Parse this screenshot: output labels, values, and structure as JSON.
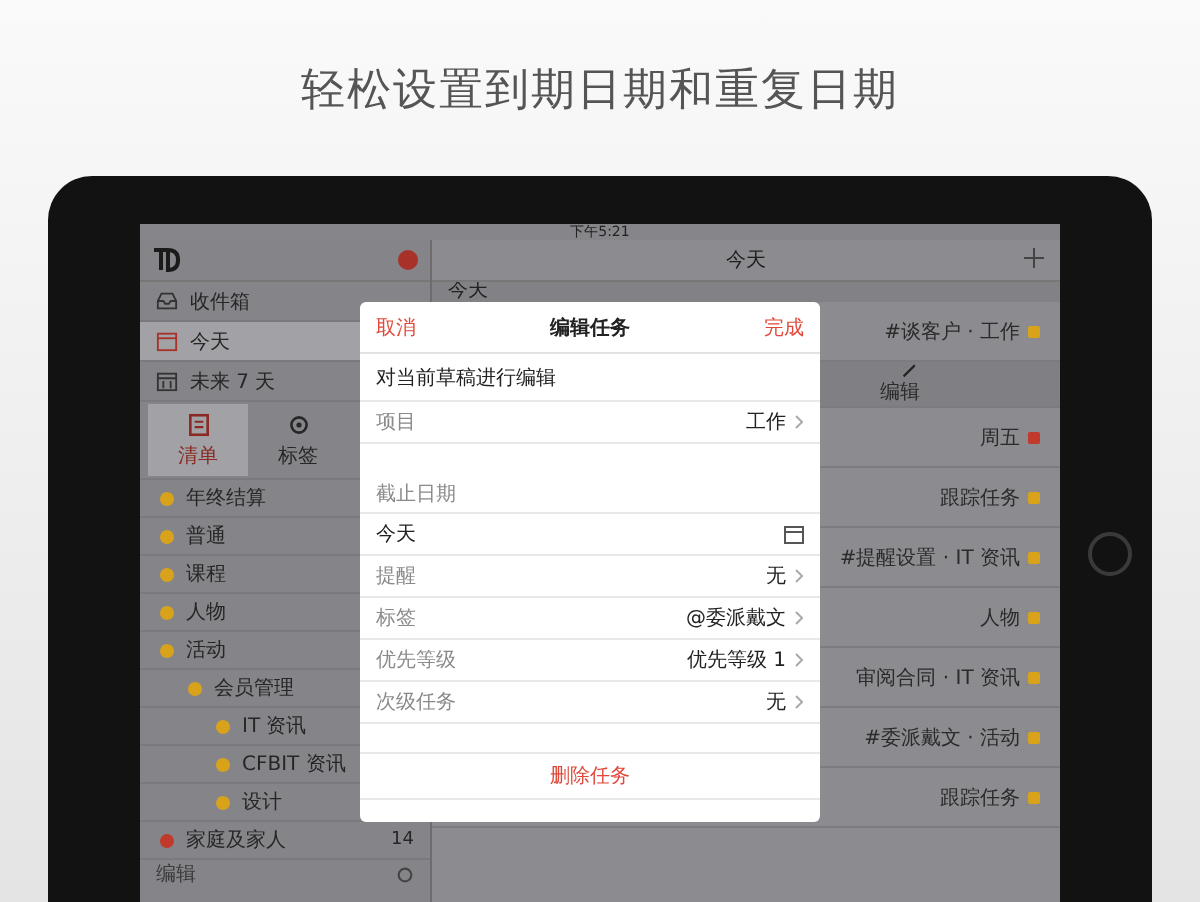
{
  "headline": "轻松设置到期日期和重复日期",
  "status_bar": {
    "time": "下午5:21"
  },
  "sidebar": {
    "items": [
      {
        "kind": "inbox",
        "label": "收件箱",
        "selected": false
      },
      {
        "kind": "today",
        "label": "今天",
        "selected": true
      },
      {
        "kind": "week",
        "label": "未来 7 天",
        "selected": false
      }
    ],
    "tabs": [
      {
        "kind": "lists",
        "label": "清单",
        "selected": true
      },
      {
        "kind": "labels",
        "label": "标签",
        "selected": false
      }
    ],
    "lists": [
      {
        "label": "年终结算",
        "color": "#d9a21b"
      },
      {
        "label": "普通",
        "color": "#d9a21b"
      },
      {
        "label": "课程",
        "color": "#d9a21b"
      },
      {
        "label": "人物",
        "color": "#d9a21b"
      },
      {
        "label": "活动",
        "color": "#d9a21b",
        "children": [
          {
            "label": "会员管理",
            "color": "#d9a21b",
            "children": [
              {
                "label": "IT 资讯",
                "color": "#d9a21b"
              },
              {
                "label": "CFBIT 资讯",
                "color": "#d9a21b"
              },
              {
                "label": "设计",
                "color": "#d9a21b"
              }
            ]
          }
        ]
      },
      {
        "label": "家庭及家人",
        "color": "#c0392b",
        "count": "14"
      }
    ],
    "footer": {
      "label": "编辑"
    }
  },
  "main": {
    "title": "今天",
    "section": "今天",
    "tasks": [
      {
        "kind": "task",
        "text": "#谈客户 · 工作",
        "color": "#d9a21b"
      },
      {
        "kind": "action",
        "text": "编辑"
      },
      {
        "kind": "task",
        "text": "周五",
        "color": "#c0392b"
      },
      {
        "kind": "task",
        "text": "跟踪任务",
        "color": "#d9a21b"
      },
      {
        "kind": "task",
        "text": "#提醒设置 · IT 资讯",
        "color": "#d9a21b"
      },
      {
        "kind": "task",
        "text": "人物",
        "color": "#d9a21b"
      },
      {
        "kind": "task",
        "text": "审阅合同 · IT 资讯",
        "color": "#d9a21b"
      },
      {
        "kind": "task",
        "text": "#委派戴文 · 活动",
        "color": "#d9a21b"
      },
      {
        "kind": "task",
        "text": "跟踪任务",
        "color": "#d9a21b"
      }
    ]
  },
  "dialog": {
    "cancel": "取消",
    "title": "编辑任务",
    "done": "完成",
    "task_title": "对当前草稿进行编辑",
    "project": {
      "label": "项目",
      "value": "工作"
    },
    "section_label": "截止日期",
    "due": {
      "value": "今天"
    },
    "rows": [
      {
        "label": "提醒",
        "value": "无"
      },
      {
        "label": "标签",
        "value": "@委派戴文"
      },
      {
        "label": "优先等级",
        "value": "优先等级 1"
      },
      {
        "label": "次级任务",
        "value": "无"
      }
    ],
    "delete": "删除任务"
  }
}
